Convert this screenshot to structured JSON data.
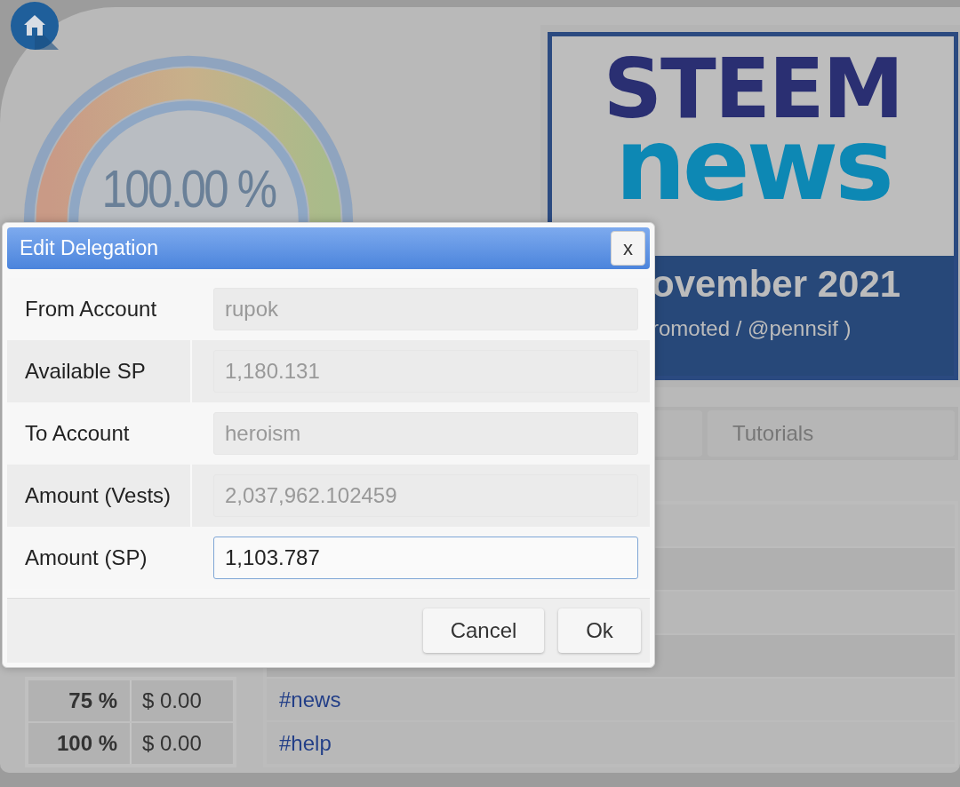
{
  "gauge": {
    "reading": "100.00 %"
  },
  "banner": {
    "title_top": "STEEM",
    "title_bottom": "news",
    "date": "ovember 2021",
    "caption": "romoted / @pennsif )"
  },
  "tabs": [
    {
      "label": "Tutorials"
    }
  ],
  "vote_table": [
    {
      "percent": "75 %",
      "value": "$ 0.00"
    },
    {
      "percent": "100 %",
      "value": "$ 0.00"
    }
  ],
  "tags": [
    "#news",
    "#help"
  ],
  "dialog": {
    "title": "Edit Delegation",
    "close": "x",
    "fields": [
      {
        "label": "From Account",
        "value": "rupok",
        "disabled": true
      },
      {
        "label": "Available SP",
        "value": "1,180.131",
        "disabled": true
      },
      {
        "label": "To Account",
        "value": "heroism",
        "disabled": true
      },
      {
        "label": "Amount (Vests)",
        "value": "2,037,962.102459",
        "disabled": true
      },
      {
        "label": "Amount (SP)",
        "value": "1,103.787",
        "disabled": false
      }
    ],
    "buttons": [
      "Cancel",
      "Ok"
    ]
  }
}
